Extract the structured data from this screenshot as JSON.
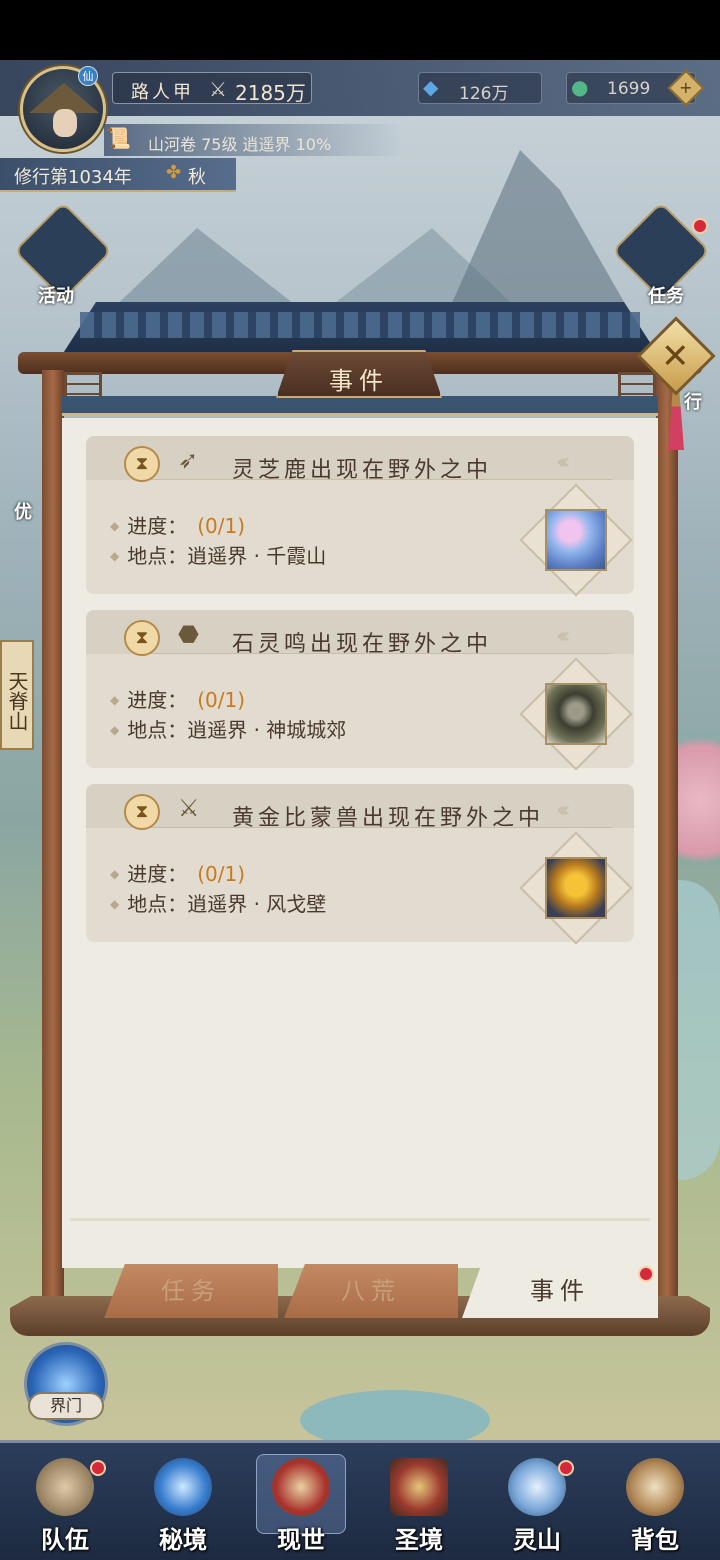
{
  "player": {
    "name": "路人甲",
    "power": "2185万",
    "avatar_badge": "仙"
  },
  "currencies": [
    {
      "icon": "crystal-icon",
      "value": "126万"
    },
    {
      "icon": "jade-coin-icon",
      "value": "1699"
    }
  ],
  "plus_label": "+",
  "progress_line": "山河卷 75级 逍遥界 10%",
  "cultivation": {
    "year": "修行第1034年",
    "season": "秋"
  },
  "side_buttons": {
    "left_top": "活动",
    "left_mid": "优",
    "right_top": "任务",
    "right_mid": "行"
  },
  "location_banner": "天脊山",
  "panel": {
    "title": "事件",
    "close": "✕"
  },
  "events": [
    {
      "title": "灵芝鹿出现在野外之中",
      "icon": "arrow-icon",
      "progress_label": "进度：",
      "progress": "(0/1)",
      "location_label": "地点：",
      "location": "逍遥界 · 千霞山",
      "portrait": "spirit-deer"
    },
    {
      "title": "石灵鸣出现在野外之中",
      "icon": "ore-icon",
      "progress_label": "进度：",
      "progress": "(0/1)",
      "location_label": "地点：",
      "location": "逍遥界 · 神城城郊",
      "portrait": "stone-spirit"
    },
    {
      "title": "黄金比蒙兽出现在野外之中",
      "icon": "crossed-swords-icon",
      "progress_label": "进度：",
      "progress": "(0/1)",
      "location_label": "地点：",
      "location": "逍遥界 · 风戈壁",
      "portrait": "golden-behemoth"
    }
  ],
  "tabs": [
    {
      "label": "任务",
      "active": false
    },
    {
      "label": "八荒",
      "active": false
    },
    {
      "label": "事件",
      "active": true
    }
  ],
  "jiemen": "界门",
  "nav": [
    {
      "label": "队伍",
      "badge": true
    },
    {
      "label": "秘境",
      "badge": false
    },
    {
      "label": "现世",
      "badge": false,
      "active": true
    },
    {
      "label": "圣境",
      "badge": false
    },
    {
      "label": "灵山",
      "badge": true
    },
    {
      "label": "背包",
      "badge": false
    }
  ]
}
